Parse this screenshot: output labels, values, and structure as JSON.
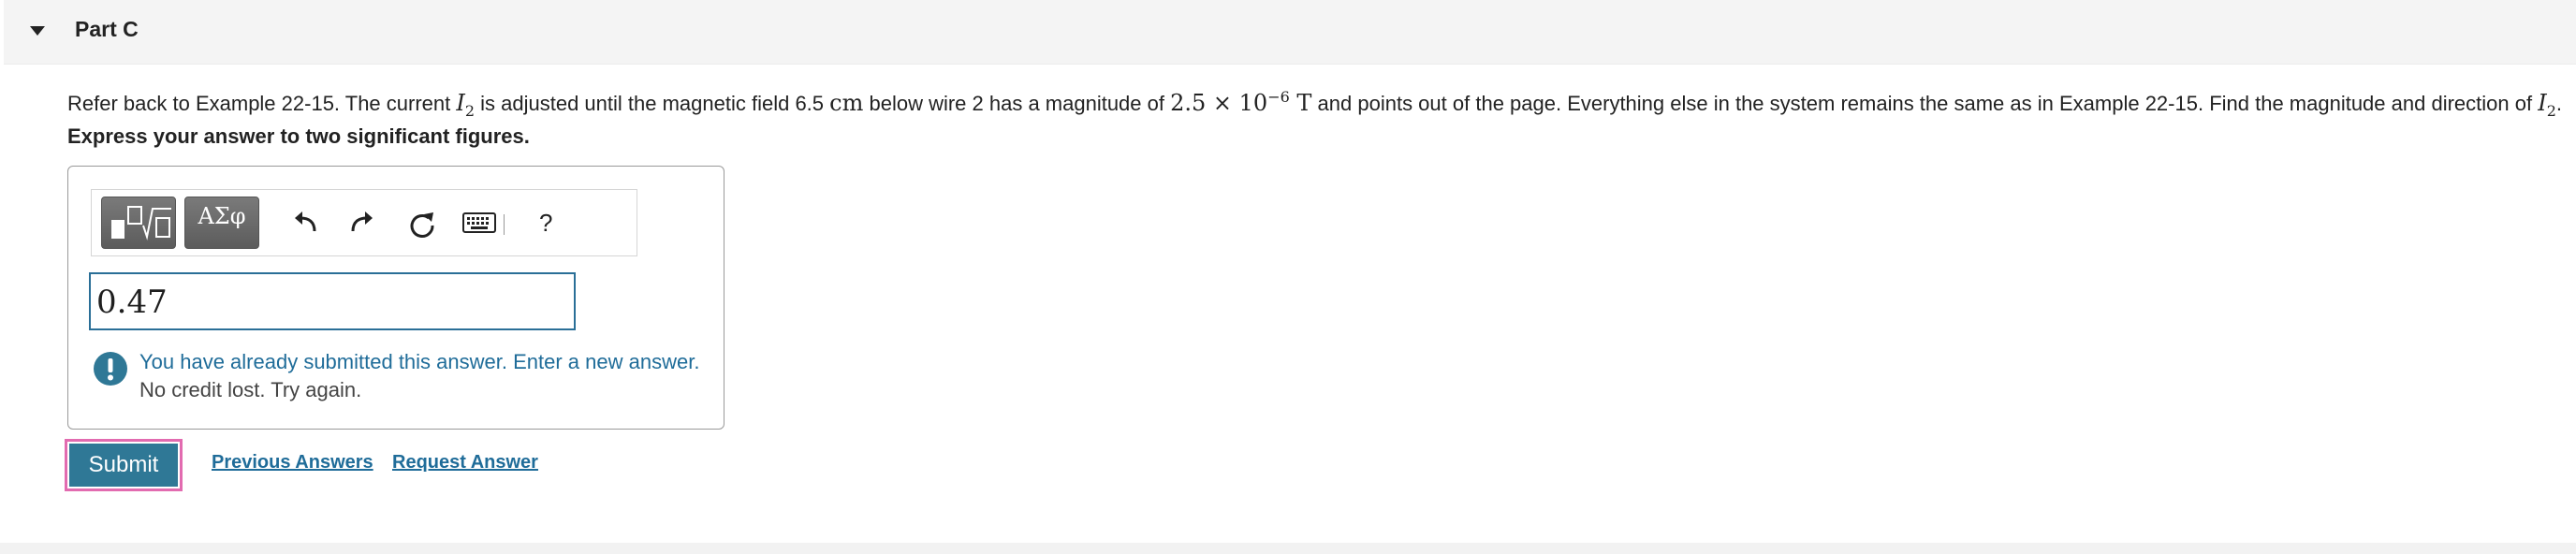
{
  "part": {
    "title": "Part C"
  },
  "problem": {
    "text_1": "Refer back to Example 22-15. The current ",
    "current_symbol": "I",
    "current_sub": "2",
    "text_2": " is adjusted until the magnetic field 6.5 ",
    "unit_cm": "cm",
    "text_3": " below wire 2 has a magnitude of ",
    "mantissa": "2.5 × 10",
    "exponent": "−6",
    "unit_T": "T",
    "text_4": " and points out of the page. Everything else in the system remains the same as in Example 22-15. Find the magnitude and direction of ",
    "end_symbol": "I",
    "end_sub": "2",
    "end_period": "."
  },
  "instruction": "Express your answer to two significant figures.",
  "toolbar": {
    "symbols_label": "ΑΣφ",
    "help_label": "?",
    "icons": [
      "templates-icon",
      "undo-icon",
      "redo-icon",
      "reset-icon",
      "keyboard-icon",
      "help-icon"
    ]
  },
  "answer": {
    "value": "0.47"
  },
  "feedback": {
    "line1": "You have already submitted this answer. Enter a new answer.",
    "line2": "No credit lost. Try again."
  },
  "actions": {
    "submit_label": "Submit",
    "previous_answers_label": "Previous Answers",
    "request_answer_label": "Request Answer"
  },
  "colors": {
    "accent": "#2f7896",
    "link": "#1f6c99",
    "focus_outline": "#e26bb0"
  }
}
